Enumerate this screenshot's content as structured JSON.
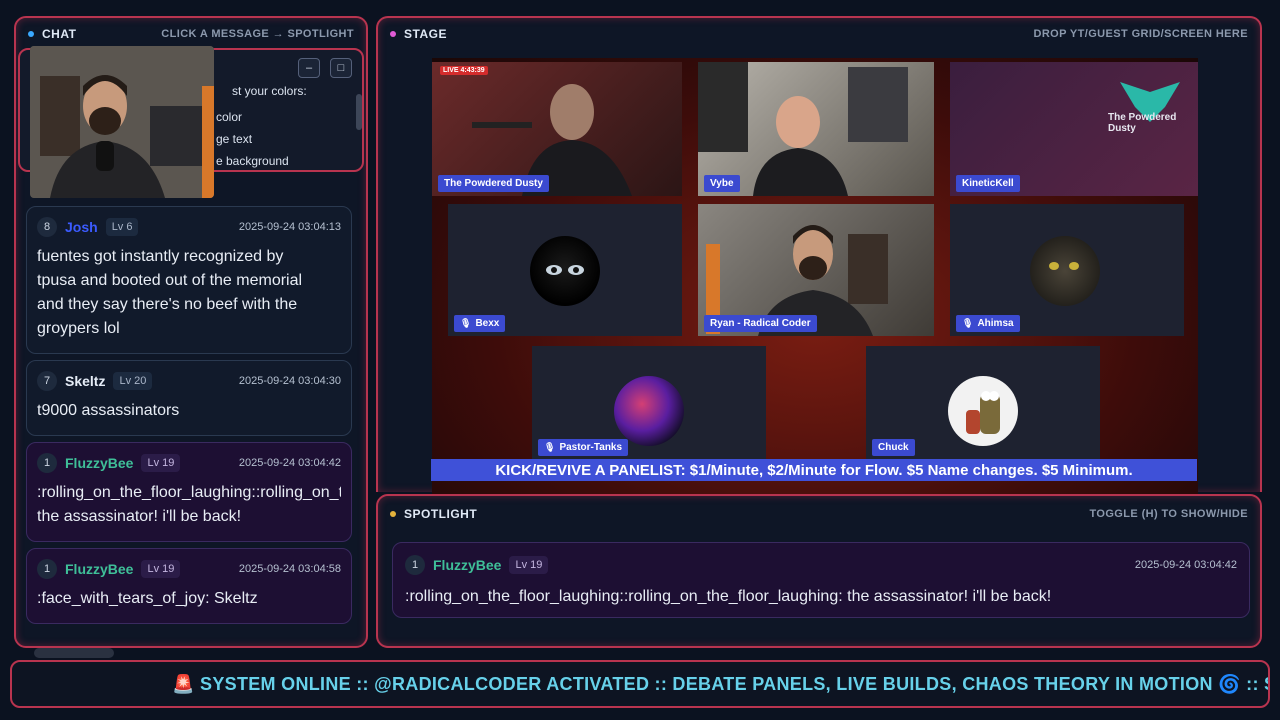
{
  "chat": {
    "title": "CHAT",
    "hint": "CLICK A MESSAGE → SPOTLIGHT",
    "popup_lines": [
      "st your colors:",
      "color",
      "ge text",
      "e background"
    ],
    "messages": [
      {
        "num": "8",
        "user": "Josh",
        "level": "Lv 6",
        "time": "2025-09-24 03:04:13",
        "lines": [
          "fuentes got instantly recognized by",
          "tpusa and booted out of the memorial",
          "and they say there's no beef with the",
          "groypers lol"
        ],
        "color": "#3b5bff",
        "style": "plain"
      },
      {
        "num": "7",
        "user": "Skeltz",
        "level": "Lv 20",
        "time": "2025-09-24 03:04:30",
        "lines": [
          "t9000 assassinators"
        ],
        "color": "#e6edf7",
        "style": "plain"
      },
      {
        "num": "1",
        "user": "FluzzyBee",
        "level": "Lv 19",
        "time": "2025-09-24 03:04:42",
        "lines": [
          ":rolling_on_the_floor_laughing::rolling_on_th",
          "the assassinator! i'll be back!"
        ],
        "color": "#3fbf98",
        "style": "purple"
      },
      {
        "num": "1",
        "user": "FluzzyBee",
        "level": "Lv 19",
        "time": "2025-09-24 03:04:58",
        "lines": [
          ":face_with_tears_of_joy: Skeltz"
        ],
        "color": "#3fbf98",
        "style": "purple"
      }
    ]
  },
  "stage": {
    "title": "STAGE",
    "hint": "DROP YT/GUEST GRID/SCREEN HERE",
    "live": "LIVE 4:43:39",
    "watermark": "The Powdered Dusty",
    "tiles": [
      {
        "label": "The Powdered Dusty",
        "muted": false
      },
      {
        "label": "Vybe",
        "muted": false
      },
      {
        "label": "KineticKell",
        "muted": false
      },
      {
        "label": "Bexx",
        "muted": true
      },
      {
        "label": "Ryan - Radical Coder",
        "muted": false
      },
      {
        "label": "Ahimsa",
        "muted": true
      },
      {
        "label": "Pastor-Tanks",
        "muted": true
      },
      {
        "label": "Chuck",
        "muted": false
      }
    ],
    "banner": "KICK/REVIVE A PANELIST: $1/Minute, $2/Minute for Flow. $5 Name changes. $5 Minimum."
  },
  "spotlight": {
    "title": "SPOTLIGHT",
    "hint": "TOGGLE (H) TO SHOW/HIDE",
    "message": {
      "num": "1",
      "user": "FluzzyBee",
      "level": "Lv 19",
      "time": "2025-09-24 03:04:42",
      "text": ":rolling_on_the_floor_laughing::rolling_on_the_floor_laughing: the assassinator! i'll be back!"
    }
  },
  "ticker": {
    "siren": "🚨",
    "text": "SYSTEM ONLINE :: @RADICALCODER ACTIVATED :: DEBATE PANELS, LIVE BUILDS, CHAOS THEORY IN MOTION",
    "swirl": "🌀",
    "tail": ":: SUB IF"
  },
  "colors": {
    "accent": "#b8344f",
    "dot_blue": "#3aa9ff",
    "dot_pink": "#e05bd6",
    "dot_yellow": "#e3b23c",
    "banner": "#3f51d8"
  }
}
